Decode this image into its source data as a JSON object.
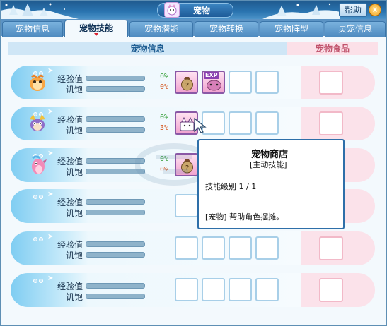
{
  "window": {
    "title": "宠物",
    "help_label": "帮助",
    "close_label": "×"
  },
  "tabs": [
    {
      "label": "宠物信息",
      "active": false
    },
    {
      "label": "宠物技能",
      "active": true
    },
    {
      "label": "宠物潜能",
      "active": false
    },
    {
      "label": "宠物转换",
      "active": false
    },
    {
      "label": "宠物阵型",
      "active": false
    },
    {
      "label": "灵宠信息",
      "active": false
    }
  ],
  "headers": {
    "info": "宠物信息",
    "food": "宠物食品"
  },
  "rows": [
    {
      "exp_label": "经验值",
      "full_label": "饥饱",
      "exp_pct": "0%",
      "full_pct": "0%",
      "pet": "orange-creature",
      "skills": [
        "money-bag-icon",
        "exp-pig-icon",
        "",
        ""
      ]
    },
    {
      "exp_label": "经验值",
      "full_label": "饥饱",
      "exp_pct": "0%",
      "full_pct": "3%",
      "pet": "purple-dog-creature",
      "skills": [
        "cat-shop-icon",
        "",
        "",
        ""
      ]
    },
    {
      "exp_label": "经验值",
      "full_label": "饥饱",
      "exp_pct": "0%",
      "full_pct": "0%",
      "pet": "pink-seahorse-creature",
      "skills": [
        "money-bag-icon",
        "",
        "",
        ""
      ]
    },
    {
      "exp_label": "经验值",
      "full_label": "饥饱",
      "exp_pct": "",
      "full_pct": "",
      "pet": "",
      "skills": [
        "",
        "",
        "",
        ""
      ]
    },
    {
      "exp_label": "经验值",
      "full_label": "饥饱",
      "exp_pct": "",
      "full_pct": "",
      "pet": "",
      "skills": [
        "",
        "",
        "",
        ""
      ]
    },
    {
      "exp_label": "经验值",
      "full_label": "饥饱",
      "exp_pct": "",
      "full_pct": "",
      "pet": "",
      "skills": [
        "",
        "",
        "",
        ""
      ]
    }
  ],
  "tooltip": {
    "title": "宠物商店",
    "type": "[主动技能]",
    "level": "技能级别 1 / 1",
    "desc": "[宠物] 帮助角色摆摊。"
  },
  "colors": {
    "exp_pct": "#2c9a2f",
    "full_pct": "#d4541b",
    "accent": "#2e6fa9"
  }
}
